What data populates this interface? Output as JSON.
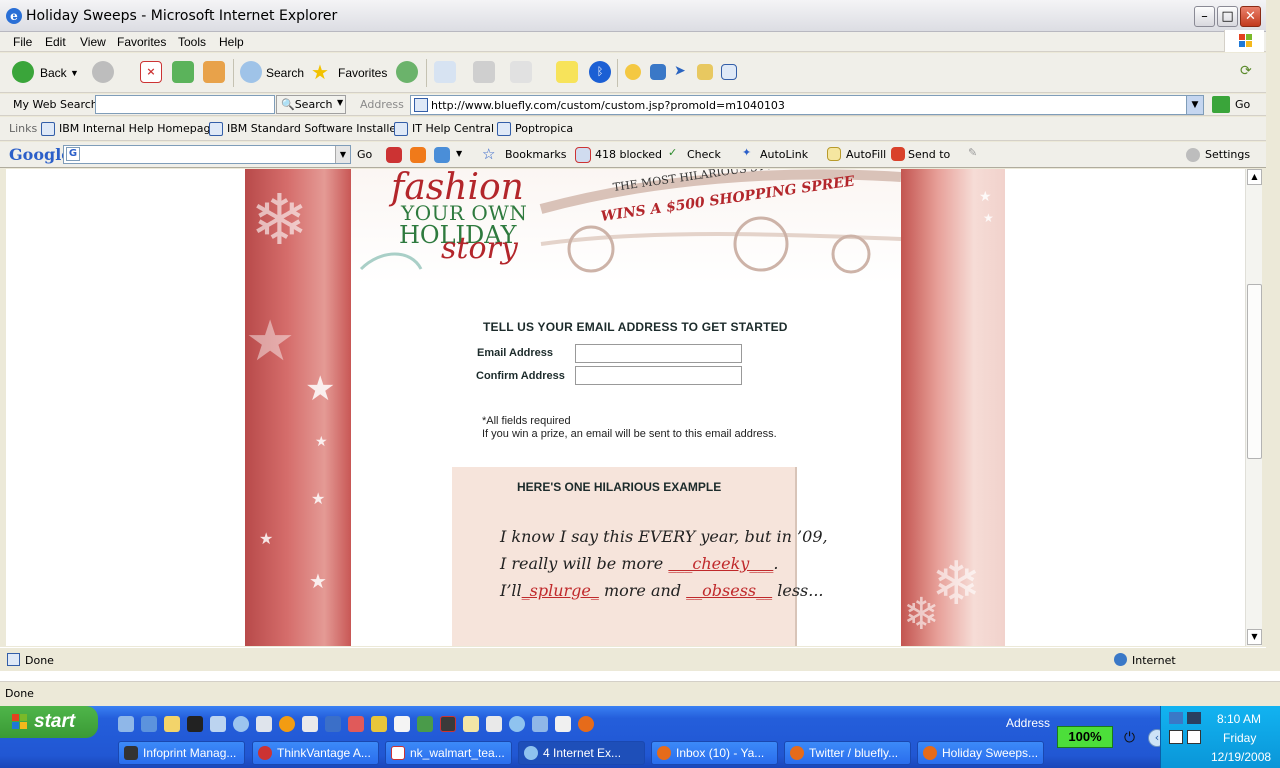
{
  "window": {
    "title": "Holiday Sweeps - Microsoft Internet Explorer"
  },
  "menu": [
    "File",
    "Edit",
    "View",
    "Favorites",
    "Tools",
    "Help"
  ],
  "toolbar": {
    "back": "Back",
    "search": "Search",
    "favorites": "Favorites"
  },
  "searchbar": {
    "label": "My Web Search",
    "button": "Search",
    "value": ""
  },
  "address": {
    "label": "Address",
    "url": "http://www.bluefly.com/custom/custom.jsp?promoId=m1040103",
    "go": "Go"
  },
  "links": {
    "label": "Links",
    "items": [
      "IBM Internal Help Homepage",
      "IBM Standard Software Installer",
      "IT Help Central",
      "Poptropica"
    ]
  },
  "google": {
    "logo": "Google",
    "go": "Go",
    "bookmarks": "Bookmarks",
    "blocked": "418 blocked",
    "check": "Check",
    "autolink": "AutoLink",
    "autofill": "AutoFill",
    "sendto": "Send to",
    "settings": "Settings"
  },
  "page": {
    "logo_line1": "fashion",
    "logo_line2": "YOUR OWN",
    "logo_line3": "HOLIDAY",
    "logo_line4": "story",
    "tag1": "THE MOST HILARIOUS STORY",
    "tag2": "WINS A $500 SHOPPING SPREE",
    "form_heading": "TELL US YOUR EMAIL ADDRESS TO GET STARTED",
    "email_label": "Email Address",
    "confirm_label": "Confirm Address",
    "note1": "*All fields required",
    "note2": "If you win a prize, an email will be sent to this email address.",
    "example_title": "HERE'S ONE HILARIOUS EXAMPLE",
    "ex_line1": "I know I say this EVERY year, but in ’09,",
    "ex_line2a": "I  really  will  be  more",
    "ex_fill1": "___cheeky___",
    "ex_line2b": ".",
    "ex_line3a": "I’ll",
    "ex_fill2": "_splurge_",
    "ex_line3b": "more and",
    "ex_fill3": "__obsess__",
    "ex_line3c": "less..."
  },
  "status": {
    "text": "Done",
    "zone": "Internet"
  },
  "outer_status": "Done",
  "taskbar": {
    "start": "start",
    "address": "Address",
    "zoom": "100%",
    "tasks": [
      "Infoprint Manag...",
      "ThinkVantage A...",
      "nk_walmart_tea...",
      "4 Internet Ex...",
      "Inbox (10) - Ya...",
      "Twitter / bluefly...",
      "Holiday Sweeps..."
    ],
    "time": "8:10 AM",
    "day": "Friday",
    "date": "12/19/2008"
  },
  "colors": {
    "accent_red": "#c0292b",
    "xp_blue": "#245edb",
    "start_green": "#3a9a35"
  }
}
